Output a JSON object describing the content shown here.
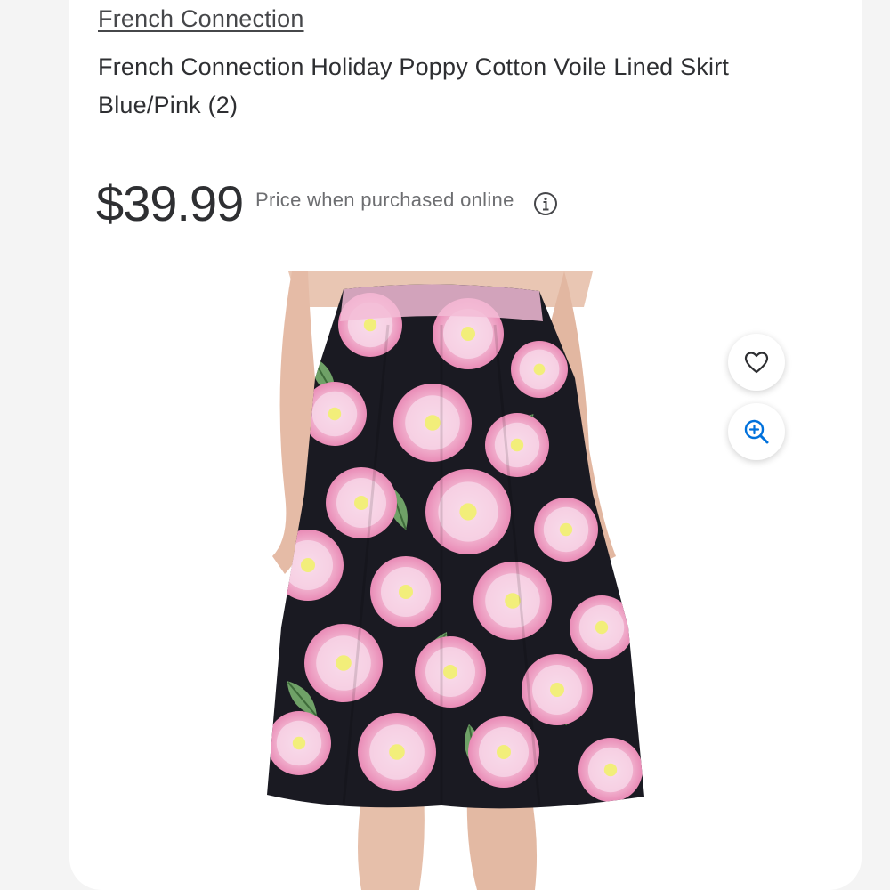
{
  "product": {
    "brand": "French Connection",
    "title": "French Connection Holiday Poppy Cotton Voile Lined Skirt Blue/Pink (2)",
    "price": "$39.99",
    "price_note": "Price when purchased online"
  },
  "icons": {
    "info": "info-icon",
    "favorite": "heart-icon",
    "zoom": "zoom-in-icon"
  },
  "colors": {
    "text": "#2e2f32",
    "muted": "#6d6e71",
    "accent": "#0071dc"
  }
}
